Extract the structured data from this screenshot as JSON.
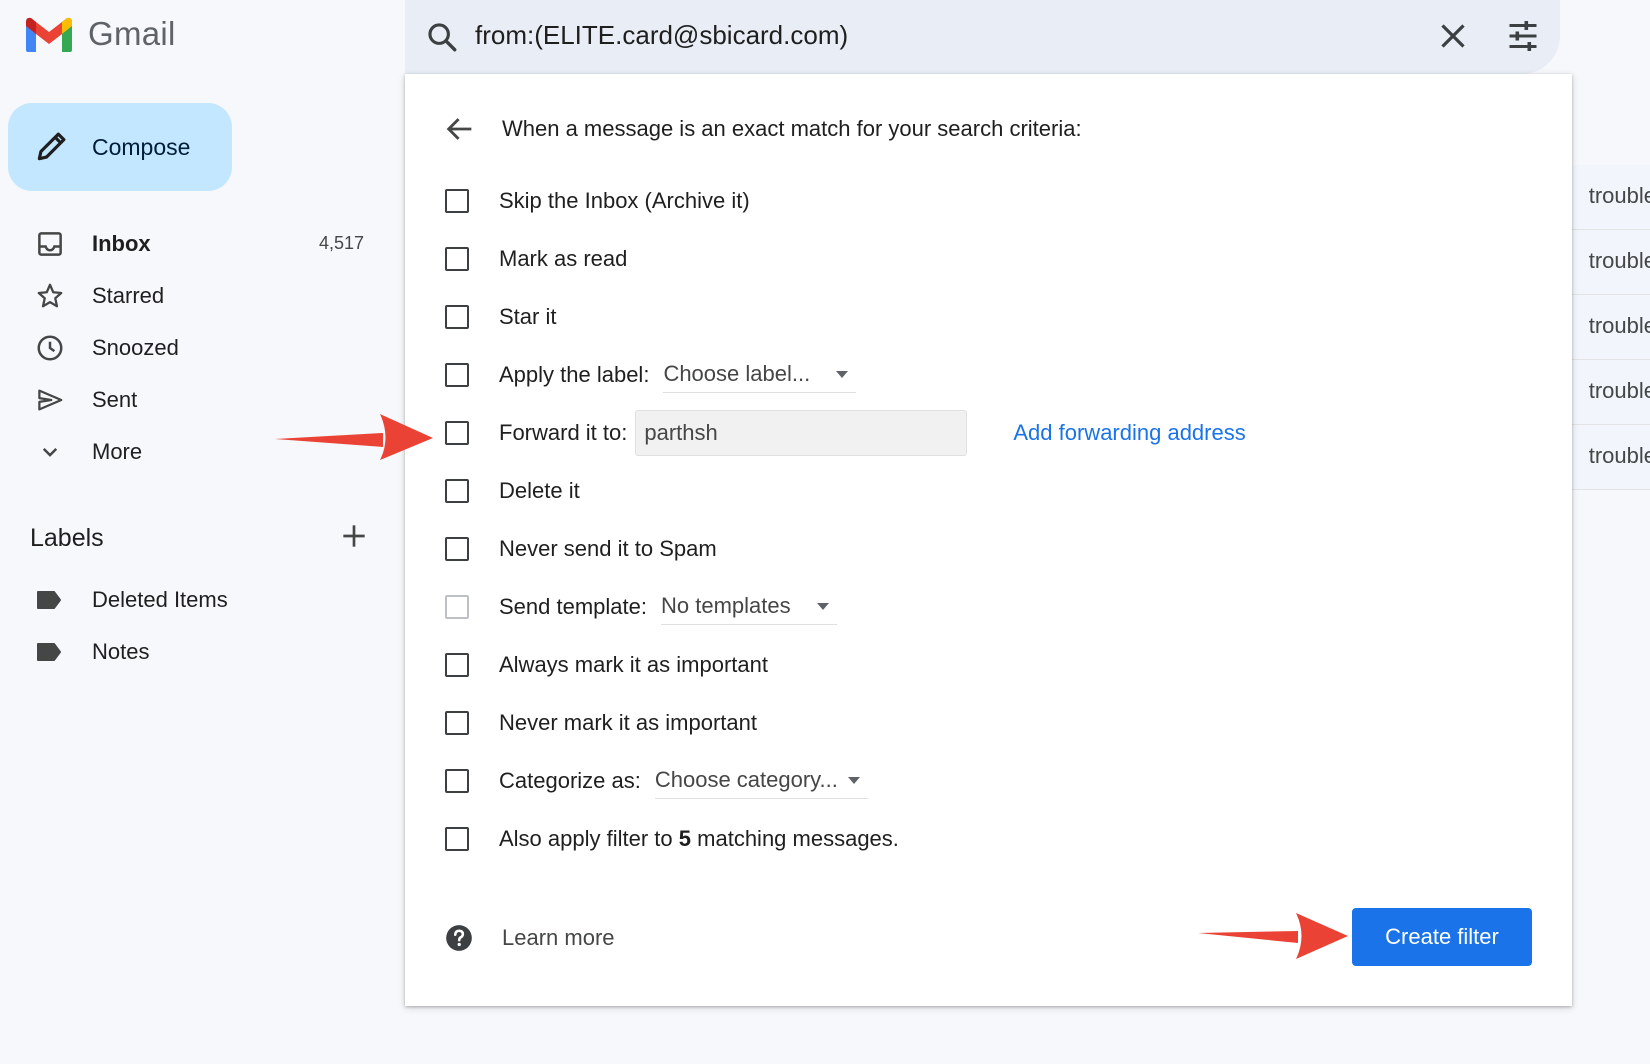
{
  "app": {
    "name": "Gmail"
  },
  "search": {
    "query": "from:(ELITE.card@sbicard.com)"
  },
  "compose": {
    "label": "Compose"
  },
  "nav": {
    "items": [
      {
        "label": "Inbox",
        "count": "4,517",
        "icon": "inbox-icon"
      },
      {
        "label": "Starred",
        "count": "",
        "icon": "star-icon"
      },
      {
        "label": "Snoozed",
        "count": "",
        "icon": "clock-icon"
      },
      {
        "label": "Sent",
        "count": "",
        "icon": "send-icon"
      },
      {
        "label": "More",
        "count": "",
        "icon": "chevron-down-icon"
      }
    ]
  },
  "labels": {
    "heading": "Labels",
    "items": [
      {
        "label": "Deleted Items",
        "icon": "label-icon"
      },
      {
        "label": "Notes",
        "icon": "label-icon"
      }
    ]
  },
  "email_snippets": [
    "trouble",
    "trouble",
    "trouble",
    "trouble",
    "trouble"
  ],
  "filter": {
    "criteria": "When a message is an exact match for your search criteria:",
    "options": {
      "skip_inbox": "Skip the Inbox (Archive it)",
      "mark_read": "Mark as read",
      "star": "Star it",
      "apply_label": "Apply the label:",
      "apply_label_value": "Choose label...",
      "forward": "Forward it to:",
      "forward_value": "parthsh",
      "add_forwarding": "Add forwarding address",
      "delete": "Delete it",
      "never_spam": "Never send it to Spam",
      "send_template": "Send template:",
      "send_template_value": "No templates",
      "always_important": "Always mark it as important",
      "never_important": "Never mark it as important",
      "categorize": "Categorize as:",
      "categorize_value": "Choose category...",
      "also_apply_pre": "Also apply filter to",
      "also_apply_count": "5",
      "also_apply_post": "matching messages."
    },
    "learn_more": "Learn more",
    "create_button": "Create filter"
  },
  "colors": {
    "accent": "#1a73e8",
    "compose_bg": "#c2e7ff",
    "annotation": "#ea4335"
  }
}
